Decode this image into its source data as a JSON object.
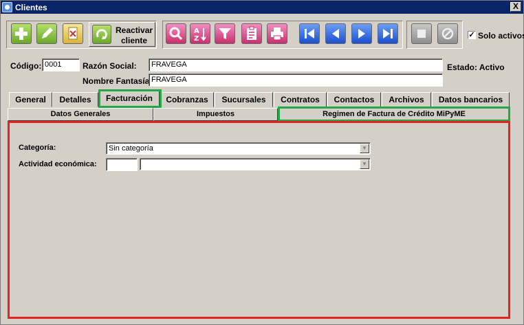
{
  "window": {
    "title": "Clientes",
    "close_label": "X"
  },
  "toolbar": {
    "reactivar_line1": "Reactivar",
    "reactivar_line2": "cliente",
    "solo_activos_label": "Solo activos",
    "solo_activos_checked": "✓"
  },
  "form": {
    "codigo_label": "Código:",
    "codigo_value": "0001",
    "razon_social_label": "Razón Social:",
    "razon_social_value": "FRAVEGA",
    "nombre_fantasia_label": "Nombre Fantasía:",
    "nombre_fantasia_value": "FRAVEGA",
    "estado_label": "Estado: Activo"
  },
  "tabs": [
    {
      "label": "General"
    },
    {
      "label": "Detalles"
    },
    {
      "label": "Facturación"
    },
    {
      "label": "Cobranzas"
    },
    {
      "label": "Sucursales"
    },
    {
      "label": "Contratos"
    },
    {
      "label": "Contactos"
    },
    {
      "label": "Archivos"
    },
    {
      "label": "Datos bancarios"
    }
  ],
  "subtabs": [
    {
      "label": "Datos Generales"
    },
    {
      "label": "Impuestos"
    },
    {
      "label": "Regimen de Factura de Crédito MiPyME"
    }
  ],
  "panel": {
    "categoria_label": "Categoría:",
    "categoria_value": "Sin categoría",
    "actividad_label": "Actividad económica:",
    "actividad_code": "",
    "actividad_value": ""
  },
  "colors": {
    "highlight_green": "#22a845",
    "highlight_red": "#e02424",
    "title_bar": "#0a246a"
  }
}
